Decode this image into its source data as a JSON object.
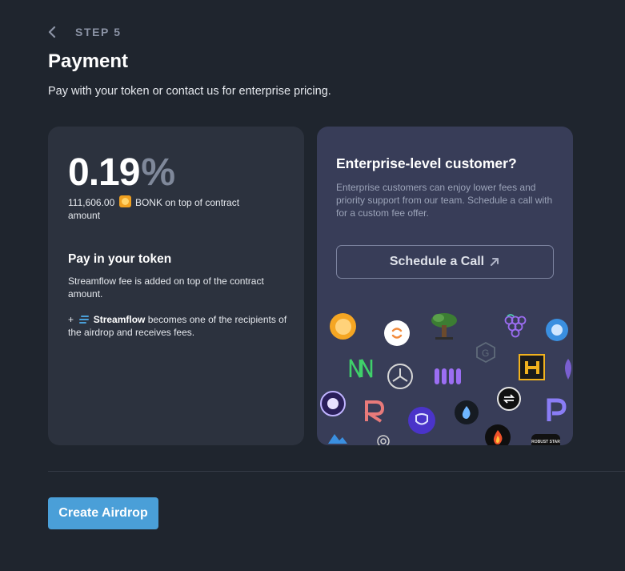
{
  "header": {
    "step_label": "STEP 5",
    "title": "Payment",
    "subtitle": "Pay with your token or contact us for enterprise pricing."
  },
  "fee_card": {
    "fee_value": "0.19",
    "fee_unit": "%",
    "amount_value": "111,606.00",
    "amount_token": "BONK on top of contract amount",
    "pay_title": "Pay in your token",
    "pay_description": "Streamflow fee is added on top of the contract amount.",
    "plus_sign": "+",
    "streamflow_name": "Streamflow",
    "streamflow_text": "becomes one of the recipients of the airdrop and receives fees."
  },
  "enterprise_card": {
    "title": "Enterprise-level customer?",
    "description": "Enterprise customers can enjoy lower fees and priority support from our team. Schedule a call with for a custom fee offer.",
    "schedule_button": "Schedule a Call",
    "partner_logo_text": "ROBUST STAR"
  },
  "footer": {
    "create_button": "Create Airdrop"
  },
  "colors": {
    "background": "#1f252e",
    "left_card": "#2c323e",
    "right_card": "#383d58",
    "accent_button": "#4a9fd8",
    "muted_text": "#8b93a5"
  }
}
